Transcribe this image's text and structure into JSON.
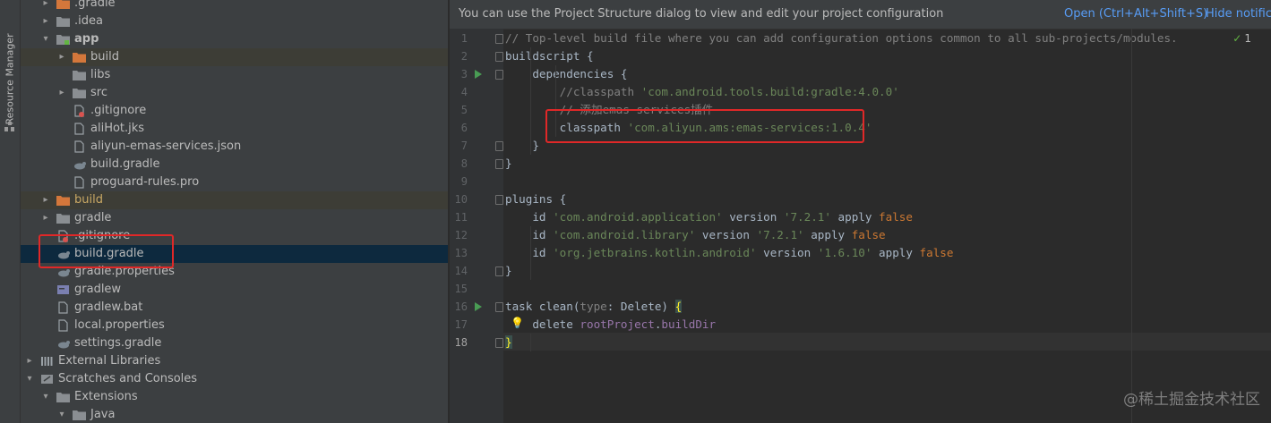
{
  "sidebar_tab": {
    "label": "Resource Manager"
  },
  "project_tree": {
    "items": [
      {
        "label": ".gradle",
        "depth": 1,
        "kind": "folder-orange",
        "arrow": "closed",
        "row_state": ""
      },
      {
        "label": ".idea",
        "depth": 1,
        "kind": "folder",
        "arrow": "closed",
        "row_state": ""
      },
      {
        "label": "app",
        "depth": 1,
        "kind": "module",
        "arrow": "open",
        "row_state": "",
        "bold": true
      },
      {
        "label": "build",
        "depth": 2,
        "kind": "folder-orange",
        "arrow": "closed",
        "row_state": "highlight"
      },
      {
        "label": "libs",
        "depth": 2,
        "kind": "folder",
        "arrow": "none",
        "row_state": ""
      },
      {
        "label": "src",
        "depth": 2,
        "kind": "folder",
        "arrow": "closed",
        "row_state": ""
      },
      {
        "label": ".gitignore",
        "depth": 2,
        "kind": "gitignore",
        "arrow": "none",
        "row_state": ""
      },
      {
        "label": "aliHot.jks",
        "depth": 2,
        "kind": "file",
        "arrow": "none",
        "row_state": ""
      },
      {
        "label": "aliyun-emas-services.json",
        "depth": 2,
        "kind": "file",
        "arrow": "none",
        "row_state": ""
      },
      {
        "label": "build.gradle",
        "depth": 2,
        "kind": "gradle",
        "arrow": "none",
        "row_state": ""
      },
      {
        "label": "proguard-rules.pro",
        "depth": 2,
        "kind": "file",
        "arrow": "none",
        "row_state": ""
      },
      {
        "label": "build",
        "depth": 1,
        "kind": "folder-orange",
        "arrow": "closed",
        "row_state": "highlight",
        "excluded": true
      },
      {
        "label": "gradle",
        "depth": 1,
        "kind": "folder",
        "arrow": "closed",
        "row_state": ""
      },
      {
        "label": ".gitignore",
        "depth": 1,
        "kind": "gitignore",
        "arrow": "none",
        "row_state": ""
      },
      {
        "label": "build.gradle",
        "depth": 1,
        "kind": "gradle",
        "arrow": "none",
        "row_state": "selected"
      },
      {
        "label": "gradle.properties",
        "depth": 1,
        "kind": "gradle",
        "arrow": "none",
        "row_state": ""
      },
      {
        "label": "gradlew",
        "depth": 1,
        "kind": "script",
        "arrow": "none",
        "row_state": ""
      },
      {
        "label": "gradlew.bat",
        "depth": 1,
        "kind": "file",
        "arrow": "none",
        "row_state": ""
      },
      {
        "label": "local.properties",
        "depth": 1,
        "kind": "file",
        "arrow": "none",
        "row_state": ""
      },
      {
        "label": "settings.gradle",
        "depth": 1,
        "kind": "gradle",
        "arrow": "none",
        "row_state": ""
      },
      {
        "label": "External Libraries",
        "depth": 0,
        "kind": "libraries",
        "arrow": "closed",
        "row_state": ""
      },
      {
        "label": "Scratches and Consoles",
        "depth": 0,
        "kind": "scratches",
        "arrow": "open",
        "row_state": ""
      },
      {
        "label": "Extensions",
        "depth": 1,
        "kind": "folder",
        "arrow": "open",
        "row_state": ""
      },
      {
        "label": "Java",
        "depth": 2,
        "kind": "folder",
        "arrow": "open",
        "row_state": ""
      }
    ]
  },
  "banner": {
    "message": "You can use the Project Structure dialog to view and edit your project configuration",
    "open_link": "Open (Ctrl+Alt+Shift+S)",
    "hide_link": "Hide notifica"
  },
  "inspection": {
    "icon": "checkmark-icon",
    "count": "1"
  },
  "editor": {
    "current_line": 18,
    "lines": [
      {
        "n": "1",
        "run": false,
        "fold": "start",
        "tokens": [
          {
            "t": "// Top-level build file where you can add configuration options common to all sub-projects/modules.",
            "c": "cm"
          }
        ]
      },
      {
        "n": "2",
        "run": false,
        "fold": "start",
        "tokens": [
          {
            "t": "buildscript {",
            "c": ""
          }
        ]
      },
      {
        "n": "3",
        "run": true,
        "fold": "start",
        "tokens": [
          {
            "t": "    dependencies {",
            "c": ""
          }
        ]
      },
      {
        "n": "4",
        "run": false,
        "fold": "",
        "tokens": [
          {
            "t": "        //classpath ",
            "c": "cm"
          },
          {
            "t": "'com.android.tools.build:gradle:4.0.0'",
            "c": "str"
          }
        ]
      },
      {
        "n": "5",
        "run": false,
        "fold": "",
        "tokens": [
          {
            "t": "        // 添加emas-services插件",
            "c": "cm"
          }
        ]
      },
      {
        "n": "6",
        "run": false,
        "fold": "",
        "tokens": [
          {
            "t": "        classpath ",
            "c": ""
          },
          {
            "t": "'com.aliyun.ams:emas-services:1.0.4'",
            "c": "str"
          }
        ]
      },
      {
        "n": "7",
        "run": false,
        "fold": "end",
        "tokens": [
          {
            "t": "    }",
            "c": ""
          }
        ]
      },
      {
        "n": "8",
        "run": false,
        "fold": "end",
        "tokens": [
          {
            "t": "}",
            "c": ""
          }
        ]
      },
      {
        "n": "9",
        "run": false,
        "fold": "",
        "tokens": []
      },
      {
        "n": "10",
        "run": false,
        "fold": "start",
        "tokens": [
          {
            "t": "plugins {",
            "c": ""
          }
        ]
      },
      {
        "n": "11",
        "run": false,
        "fold": "",
        "tokens": [
          {
            "t": "    id ",
            "c": ""
          },
          {
            "t": "'com.android.application'",
            "c": "str"
          },
          {
            "t": " version ",
            "c": ""
          },
          {
            "t": "'7.2.1'",
            "c": "str"
          },
          {
            "t": " apply ",
            "c": ""
          },
          {
            "t": "false",
            "c": "kw"
          }
        ]
      },
      {
        "n": "12",
        "run": false,
        "fold": "",
        "tokens": [
          {
            "t": "    id ",
            "c": ""
          },
          {
            "t": "'com.android.library'",
            "c": "str"
          },
          {
            "t": " version ",
            "c": ""
          },
          {
            "t": "'7.2.1'",
            "c": "str"
          },
          {
            "t": " apply ",
            "c": ""
          },
          {
            "t": "false",
            "c": "kw"
          }
        ]
      },
      {
        "n": "13",
        "run": false,
        "fold": "",
        "tokens": [
          {
            "t": "    id ",
            "c": ""
          },
          {
            "t": "'org.jetbrains.kotlin.android'",
            "c": "str"
          },
          {
            "t": " version ",
            "c": ""
          },
          {
            "t": "'1.6.10'",
            "c": "str"
          },
          {
            "t": " apply ",
            "c": ""
          },
          {
            "t": "false",
            "c": "kw"
          }
        ]
      },
      {
        "n": "14",
        "run": false,
        "fold": "end",
        "tokens": [
          {
            "t": "}",
            "c": ""
          }
        ]
      },
      {
        "n": "15",
        "run": false,
        "fold": "",
        "tokens": []
      },
      {
        "n": "16",
        "run": true,
        "fold": "start",
        "tokens": [
          {
            "t": "task clean(",
            "c": ""
          },
          {
            "t": "type",
            "c": "par"
          },
          {
            "t": ": Delete) ",
            "c": ""
          },
          {
            "t": "{",
            "c": "bm"
          }
        ]
      },
      {
        "n": "17",
        "run": false,
        "fold": "bulb",
        "tokens": [
          {
            "t": "    delete ",
            "c": ""
          },
          {
            "t": "rootProject",
            "c": "pn"
          },
          {
            "t": ".",
            "c": ""
          },
          {
            "t": "buildDir",
            "c": "pn"
          }
        ]
      },
      {
        "n": "18",
        "run": false,
        "fold": "end",
        "tokens": [
          {
            "t": "}",
            "c": "bm"
          }
        ]
      }
    ]
  },
  "watermark": "@稀土掘金技术社区",
  "colors": {
    "highlight_box": "#e02828",
    "selection": "#0d293e",
    "link": "#589df6"
  }
}
